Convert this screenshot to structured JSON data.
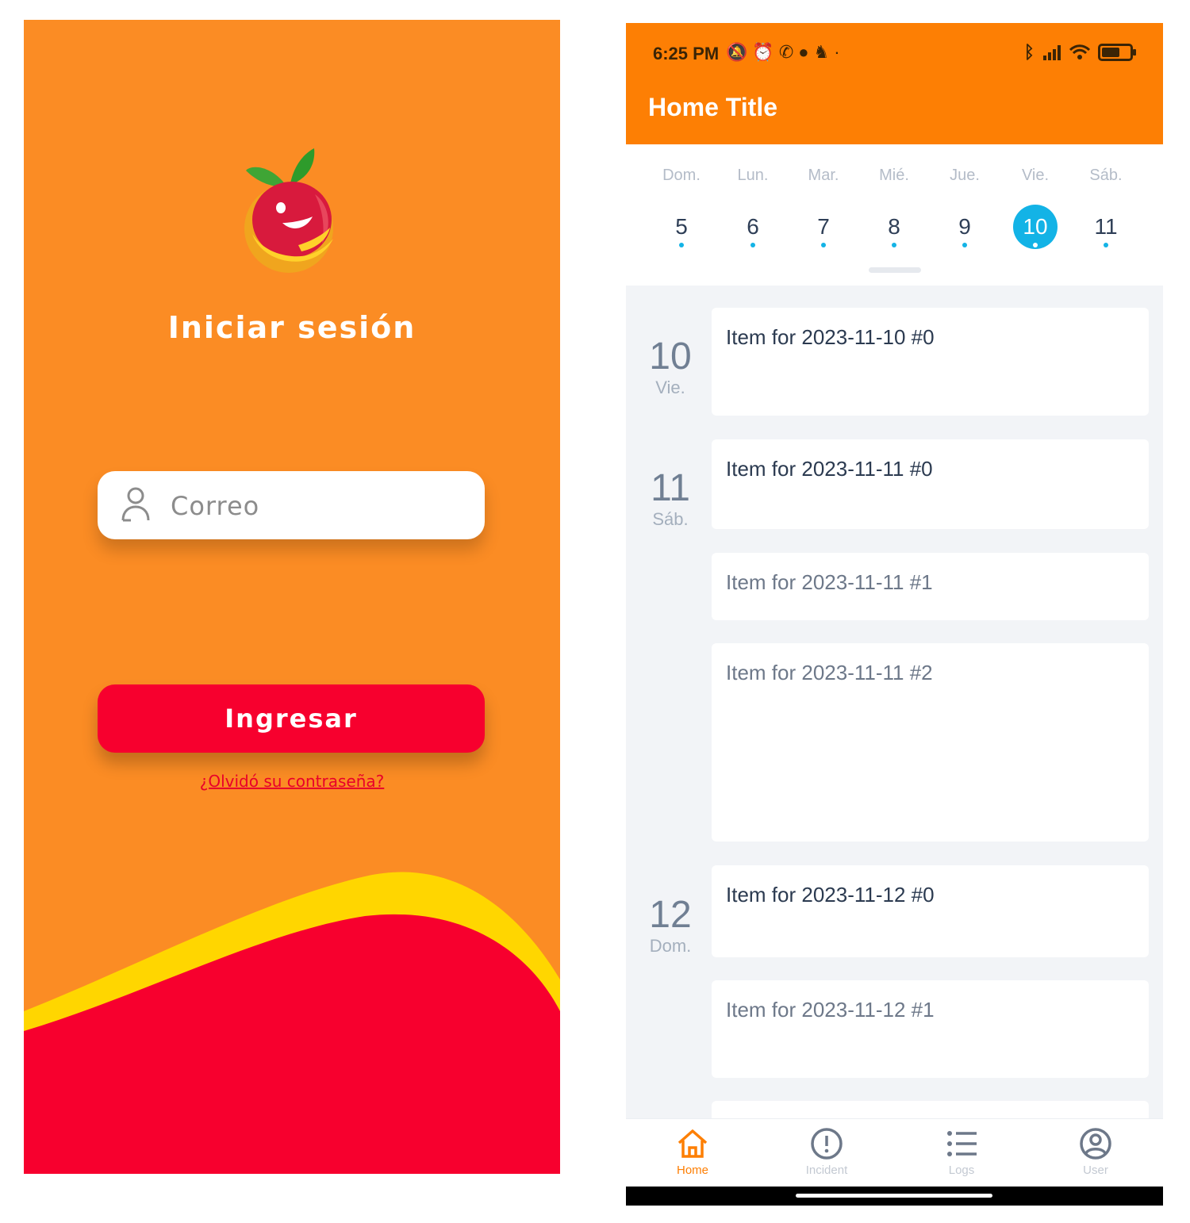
{
  "login": {
    "title": "Iniciar sesión",
    "email_placeholder": "Correo",
    "submit_label": "Ingresar",
    "forgot_label": "¿Olvidó su contraseña?"
  },
  "status_bar": {
    "time": "6:25 PM",
    "notification_icons": [
      "muted-bell-icon",
      "alarm-icon",
      "whatsapp-icon",
      "chat-bubble-icon",
      "game-controller-icon",
      "dot"
    ],
    "system_icons": [
      "bluetooth-icon",
      "signal-icon",
      "wifi-icon",
      "battery-icon"
    ],
    "battery_level": 0.68
  },
  "app_bar": {
    "title": "Home Title"
  },
  "week": {
    "days": [
      {
        "name": "Dom.",
        "num": "5",
        "selected": false
      },
      {
        "name": "Lun.",
        "num": "6",
        "selected": false
      },
      {
        "name": "Mar.",
        "num": "7",
        "selected": false
      },
      {
        "name": "Mié.",
        "num": "8",
        "selected": false
      },
      {
        "name": "Jue.",
        "num": "9",
        "selected": false
      },
      {
        "name": "Vie.",
        "num": "10",
        "selected": true
      },
      {
        "name": "Sáb.",
        "num": "11",
        "selected": false
      }
    ]
  },
  "agenda": {
    "groups": [
      {
        "day": "10",
        "weekday": "Vie.",
        "items": [
          "Item for 2023-11-10 #0"
        ]
      },
      {
        "day": "11",
        "weekday": "Sáb.",
        "items": [
          "Item for 2023-11-11 #0",
          "Item for 2023-11-11 #1",
          "Item for 2023-11-11 #2"
        ]
      },
      {
        "day": "12",
        "weekday": "Dom.",
        "items": [
          "Item for 2023-11-12 #0",
          "Item for 2023-11-12 #1"
        ]
      }
    ]
  },
  "bottom_nav": {
    "items": [
      {
        "label": "Home",
        "icon": "home-icon",
        "active": true
      },
      {
        "label": "Incident",
        "icon": "alert-circle-icon",
        "active": false
      },
      {
        "label": "Logs",
        "icon": "list-icon",
        "active": false
      },
      {
        "label": "User",
        "icon": "user-circle-icon",
        "active": false
      }
    ]
  },
  "colors": {
    "login_bg": "#fb8c24",
    "wave_red": "#f7002e",
    "wave_yellow": "#ffd600",
    "app_bar": "#fd7f04",
    "selected_day": "#13b3e6",
    "agenda_bg": "#f2f4f7"
  }
}
